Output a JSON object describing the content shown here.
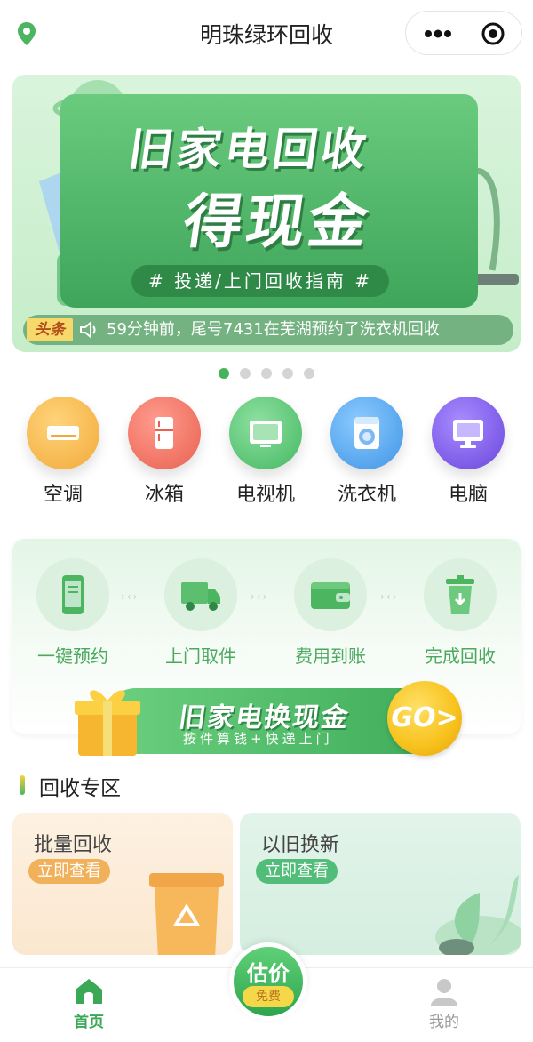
{
  "header": {
    "title": "明珠绿环回收"
  },
  "banner": {
    "title_line1": "旧家电回收",
    "title_line2": "得现金",
    "pill": "# 投递/上门回收指南 #",
    "news_tag": "头条",
    "news_text": "59分钟前，尾号7431在芜湖预约了洗衣机回收",
    "page_count": 5,
    "active_page": 1
  },
  "categories": [
    {
      "label": "空调",
      "icon": "air-conditioner-icon",
      "color": "#f6b84a"
    },
    {
      "label": "冰箱",
      "icon": "fridge-icon",
      "color": "#f0786a"
    },
    {
      "label": "电视机",
      "icon": "tv-icon",
      "color": "#57c278"
    },
    {
      "label": "洗衣机",
      "icon": "washing-machine-icon",
      "color": "#52a8ee"
    },
    {
      "label": "电脑",
      "icon": "computer-icon",
      "color": "#7a5ee6"
    }
  ],
  "steps": [
    {
      "label": "一键预约",
      "icon": "phone-icon"
    },
    {
      "label": "上门取件",
      "icon": "truck-icon"
    },
    {
      "label": "费用到账",
      "icon": "wallet-icon"
    },
    {
      "label": "完成回收",
      "icon": "trash-bin-icon"
    }
  ],
  "promo": {
    "title": "旧家电换现金",
    "subtitle": "按件算钱+快递上门",
    "go": "GO>"
  },
  "section": {
    "title": "回收专区"
  },
  "zones": [
    {
      "title": "批量回收",
      "button": "立即查看"
    },
    {
      "title": "以旧换新",
      "button": "立即查看"
    }
  ],
  "tabbar": {
    "home": "首页",
    "estimate_title": "估价",
    "estimate_badge": "免费",
    "me": "我的"
  },
  "colors": {
    "accent": "#3ba856",
    "orange_zone": "#f0b15a",
    "green_zone": "#52bd78"
  }
}
